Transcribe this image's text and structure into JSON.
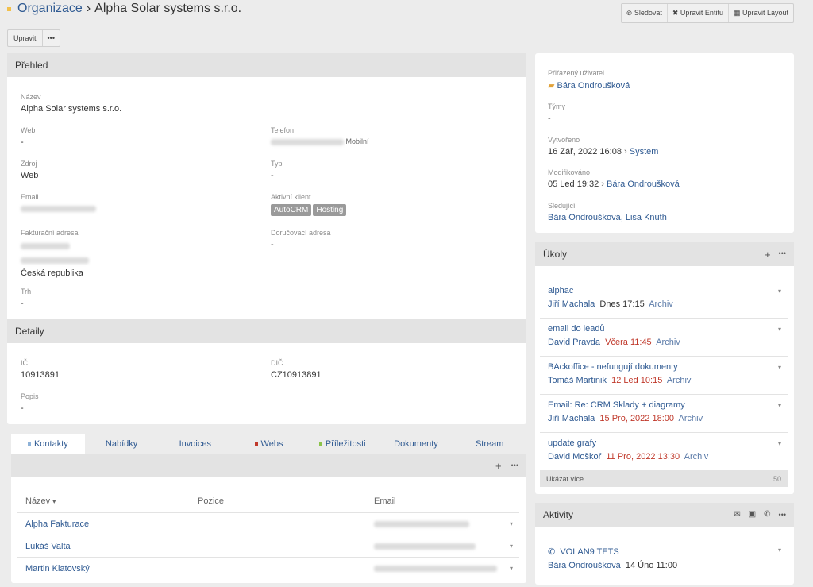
{
  "header": {
    "root": "Organizace",
    "separator": "›",
    "title": "Alpha Solar systems s.r.o.",
    "buttons": [
      "Sledovat",
      "Upravit Entitu",
      "Upravit Layout"
    ],
    "edit_label": "Upravit",
    "more_label": "•••"
  },
  "overview": {
    "title": "Přehled",
    "name_label": "Název",
    "name": "Alpha Solar systems s.r.o.",
    "web_label": "Web",
    "web": "-",
    "phone_label": "Telefon",
    "phone_type": "Mobilní",
    "source_label": "Zdroj",
    "source": "Web",
    "type_label": "Typ",
    "type": "-",
    "email_label": "Email",
    "client_label": "Aktivní klient",
    "client_tags": [
      "AutoCRM",
      "Hosting"
    ],
    "billing_label": "Fakturační adresa",
    "billing_country": "Česká republika",
    "shipping_label": "Doručovací adresa",
    "shipping": "-",
    "market_label": "Trh",
    "market": "-"
  },
  "details": {
    "title": "Detaily",
    "ic_label": "IČ",
    "ic": "10913891",
    "dic_label": "DIČ",
    "dic": "CZ10913891",
    "desc_label": "Popis",
    "desc": "-"
  },
  "tabs": [
    "Kontakty",
    "Nabídky",
    "Invoices",
    "Webs",
    "Příležitosti",
    "Dokumenty",
    "Stream"
  ],
  "tab_dot_colors": [
    "#8eb2d8",
    "",
    "",
    "#c0392b",
    "#8bc34a",
    "",
    ""
  ],
  "contacts": {
    "col_name": "Název",
    "col_position": "Pozice",
    "col_email": "Email",
    "rows": [
      "Alpha Fakturace",
      "Lukáš Valta",
      "Martin Klatovský"
    ]
  },
  "side": {
    "assigned_label": "Přiřazený uživatel",
    "assigned": "Bára Ondroušková",
    "teams_label": "Týmy",
    "teams": "-",
    "created_label": "Vytvořeno",
    "created": "16 Zář, 2022 16:08",
    "created_by": "System",
    "modified_label": "Modifikováno",
    "modified": "05 Led 19:32",
    "modified_by": "Bára Ondroušková",
    "followers_label": "Sledující",
    "followers": "Bára Ondroušková, Lisa Knuth"
  },
  "tasks": {
    "title": "Úkoly",
    "items": [
      {
        "name": "alphac",
        "user": "Jiří Machala",
        "date": "Dnes 17:15",
        "status": "Archiv",
        "overdue": false
      },
      {
        "name": "email do leadů",
        "user": "David Pravda",
        "date": "Včera 11:45",
        "status": "Archiv",
        "overdue": true
      },
      {
        "name": "BAckoffice - nefungují dokumenty",
        "user": "Tomáš Martinik",
        "date": "12 Led 10:15",
        "status": "Archiv",
        "overdue": true
      },
      {
        "name": "Email: Re: CRM Sklady + diagramy",
        "user": "Jiří Machala",
        "date": "15 Pro, 2022 18:00",
        "status": "Archiv",
        "overdue": true
      },
      {
        "name": "update grafy",
        "user": "David Moškoř",
        "date": "11 Pro, 2022 13:30",
        "status": "Archiv",
        "overdue": true
      }
    ],
    "show_more": "Ukázat více",
    "count": "50"
  },
  "activities": {
    "title": "Aktivity",
    "item_name": "VOLAN9 TETS",
    "item_user": "Bára Ondroušková",
    "item_date": "14 Úno 11:00"
  }
}
